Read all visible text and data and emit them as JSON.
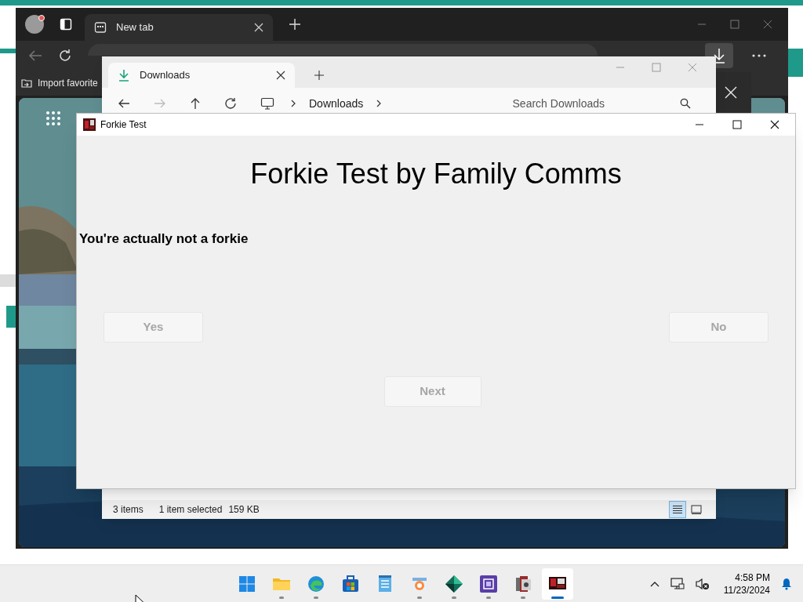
{
  "browser": {
    "tabs": [
      {
        "label": "New tab",
        "selected": true
      }
    ],
    "bookmarks": [
      {
        "label": "Import favorite"
      }
    ]
  },
  "explorer": {
    "tabs": [
      {
        "label": "Downloads",
        "selected": true
      }
    ],
    "breadcrumb": [
      "Downloads"
    ],
    "search": {
      "placeholder": "Search Downloads"
    },
    "status_bar": {
      "item_count": "3 items",
      "selection": "1 item selected",
      "size": "159 KB"
    },
    "views": [
      {
        "kind": "details",
        "selected": true
      },
      {
        "kind": "tiles",
        "selected": false
      }
    ]
  },
  "dialog": {
    "title": "Forkie Test",
    "heading": "Forkie Test by Family Comms",
    "message": "You're actually not a forkie",
    "buttons": [
      {
        "label": "Yes",
        "disabled": true
      },
      {
        "label": "No",
        "disabled": true
      },
      {
        "label": "Next",
        "disabled": true
      }
    ]
  },
  "taskbar": {
    "apps": [
      {
        "kind": "start",
        "running": false,
        "selected": false
      },
      {
        "kind": "folder",
        "running": true,
        "selected": false
      },
      {
        "kind": "edge",
        "running": true,
        "selected": false
      },
      {
        "kind": "store",
        "running": false,
        "selected": false
      },
      {
        "kind": "notepad",
        "running": false,
        "selected": false
      },
      {
        "kind": "paint",
        "running": true,
        "selected": false
      },
      {
        "kind": "diamond",
        "running": true,
        "selected": false
      },
      {
        "kind": "chip",
        "running": true,
        "selected": false
      },
      {
        "kind": "archive",
        "running": true,
        "selected": false
      },
      {
        "kind": "forkie",
        "running": true,
        "selected": true
      }
    ],
    "clock": {
      "time": "4:58 PM",
      "date": "11/23/2024"
    }
  }
}
